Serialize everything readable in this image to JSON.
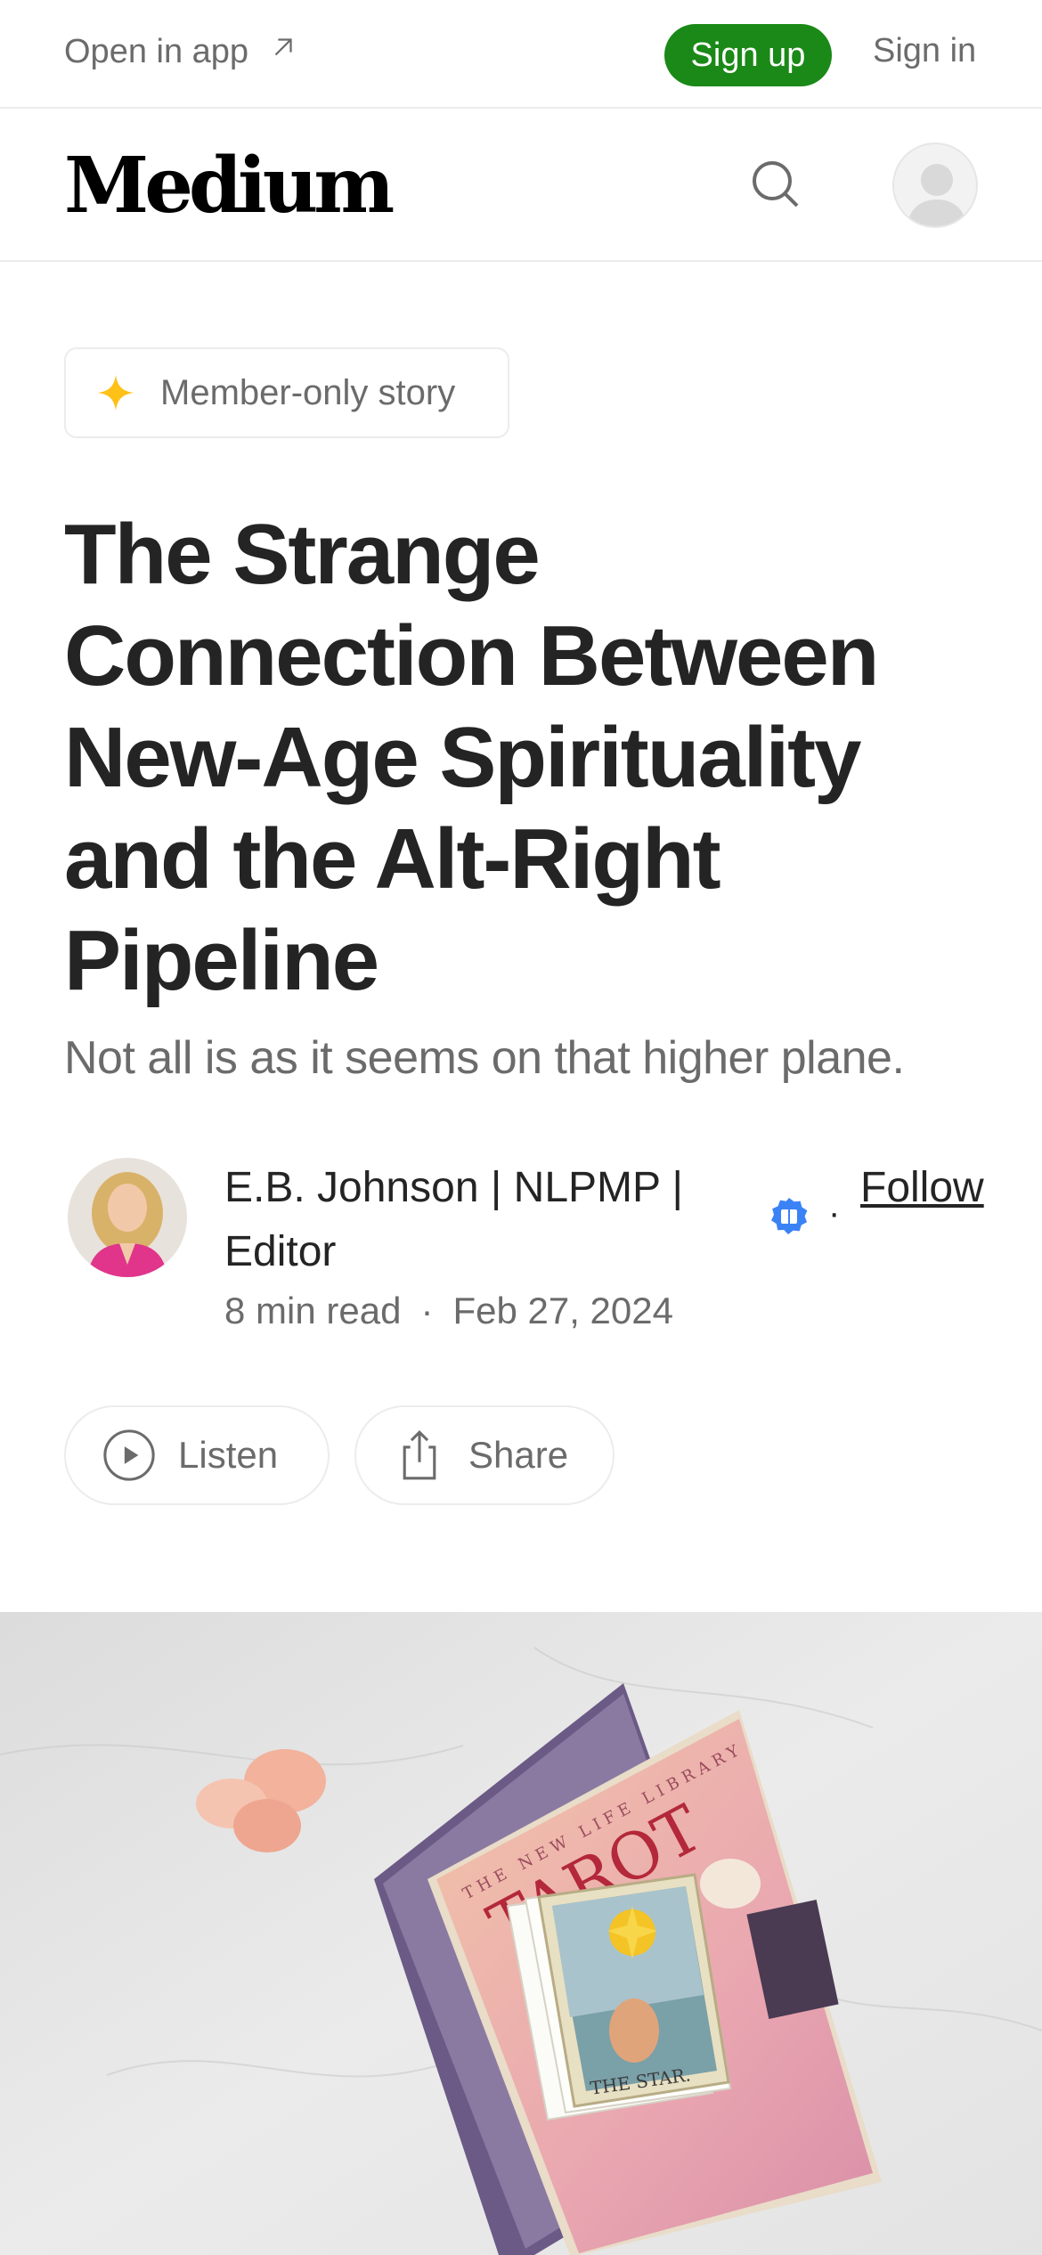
{
  "topbar": {
    "open_in_app": "Open in app",
    "sign_up": "Sign up",
    "sign_in": "Sign in"
  },
  "header": {
    "logo": "Medium"
  },
  "badge": {
    "label": "Member-only story"
  },
  "article": {
    "title": "The Strange Connection Between New-Age Spirituality and the Alt-Right Pipeline",
    "subtitle": "Not all is as it seems on that higher plane."
  },
  "author": {
    "name": "E.B. Johnson | NLPMP | Editor",
    "separator": "·",
    "follow": "Follow"
  },
  "meta": {
    "read_time": "8 min read",
    "dot": "·",
    "date": "Feb 27, 2024"
  },
  "actions": {
    "listen": "Listen",
    "share": "Share"
  },
  "hero_image": {
    "book_title": "TAROT",
    "book_series": "THE NEW LIFE LIBRARY",
    "card_label": "THE STAR."
  },
  "colors": {
    "brand_green": "#1a8917",
    "star_gold": "#ffc017",
    "pub_blue": "#3b82f6"
  },
  "icons": [
    "arrow-up-right-icon",
    "search-icon",
    "user-icon",
    "sparkle-icon",
    "publication-badge-icon",
    "play-icon",
    "share-icon"
  ]
}
